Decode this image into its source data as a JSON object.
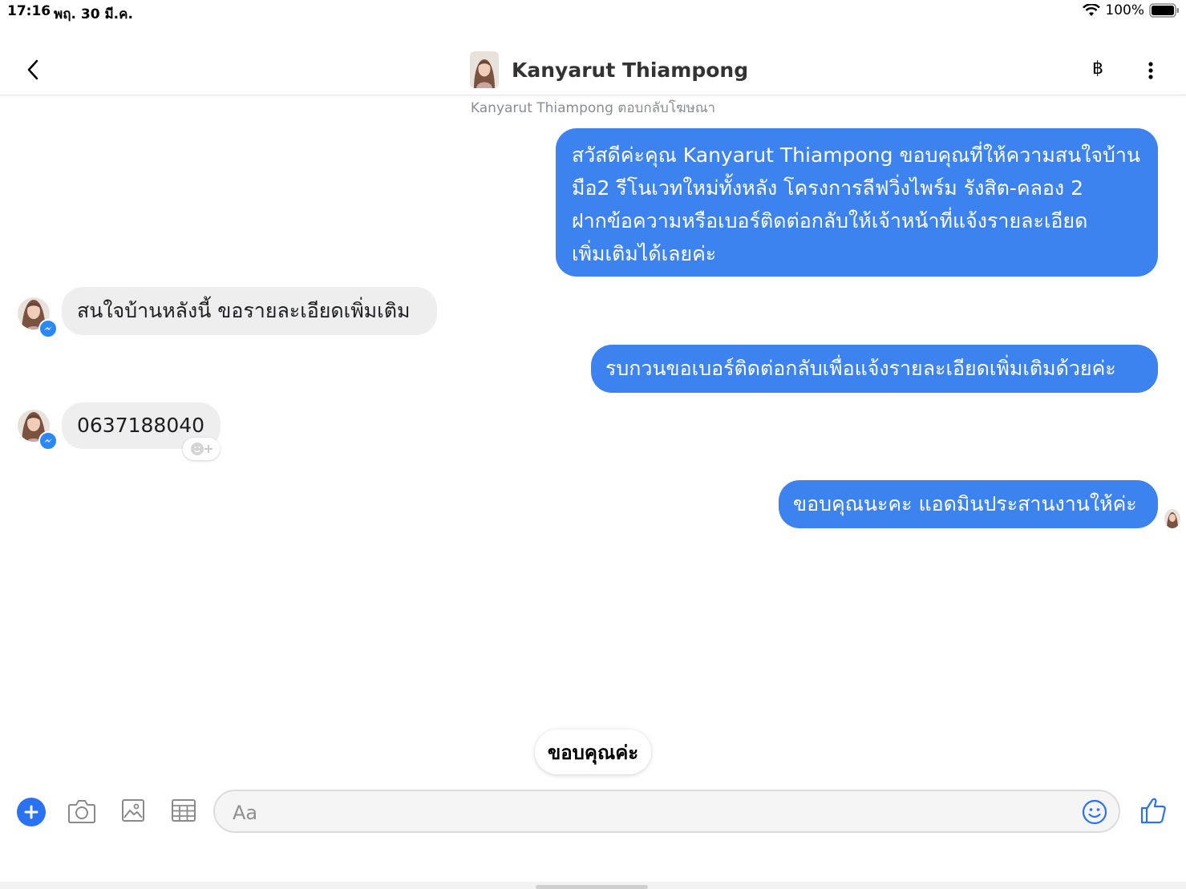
{
  "status_bar": {
    "time": "17:16",
    "date": "พฤ. 30 มี.ค.",
    "battery": "100%"
  },
  "header": {
    "contact_name": "Kanyarut Thiampong",
    "baht_symbol": "฿"
  },
  "reply_note": "Kanyarut Thiampong ตอบกลับโฆษณา",
  "messages": [
    {
      "direction": "outgoing",
      "text": "สวัสดีค่ะคุณ Kanyarut Thiampong ขอบคุณที่ให้ความสนใจบ้าน\nมือ2 รีโนเวทใหม่ทั้งหลัง โครงการลีฟวิ่งไพร์ม รังสิต-คลอง 2\nฝากข้อความหรือเบอร์ติดต่อกลับให้เจ้าหน้าที่แจ้งรายละเอียด\nเพิ่มเติมได้เลยค่ะ"
    },
    {
      "direction": "incoming",
      "text": "สนใจบ้านหลังนี้ ขอรายละเอียดเพิ่มเติม"
    },
    {
      "direction": "outgoing",
      "text": "รบกวนขอเบอร์ติดต่อกลับเพื่อแจ้งรายละเอียดเพิ่มเติมด้วยค่ะ"
    },
    {
      "direction": "incoming",
      "text": "0637188040"
    },
    {
      "direction": "outgoing",
      "text": "ขอบคุณนะคะ แอดมินประสานงานให้ค่ะ"
    }
  ],
  "quick_reply": "ขอบคุณค่ะ",
  "composer": {
    "placeholder": "Aa",
    "value": ""
  },
  "colors": {
    "outgoing_bubble": "#3c83f0",
    "incoming_bubble": "#eeeeef",
    "accent": "#2b72f3"
  },
  "icons": [
    "back-icon",
    "baht-icon",
    "more-icon",
    "plus-icon",
    "camera-icon",
    "image-icon",
    "grid-icon",
    "emoji-icon",
    "like-icon",
    "messenger-badge-icon",
    "add-reaction-icon",
    "wifi-icon",
    "battery-icon"
  ]
}
